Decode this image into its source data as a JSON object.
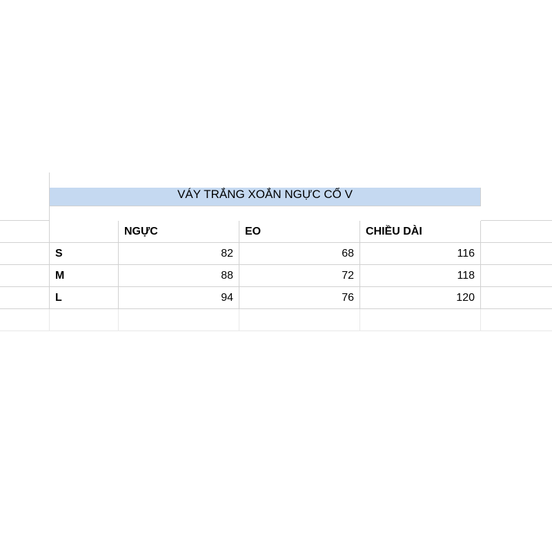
{
  "title": "VÁY TRẮNG XOẮN NGỰC CỔ V",
  "headers": {
    "col_c": "NGỰC",
    "col_d": "EO",
    "col_e": "CHIỀU DÀI"
  },
  "rows": [
    {
      "size": "S",
      "ngu_c": "82",
      "eo": "68",
      "dai": "116"
    },
    {
      "size": "M",
      "ngu_c": "88",
      "eo": "72",
      "dai": "118"
    },
    {
      "size": "L",
      "ngu_c": "94",
      "eo": "76",
      "dai": "120"
    }
  ]
}
